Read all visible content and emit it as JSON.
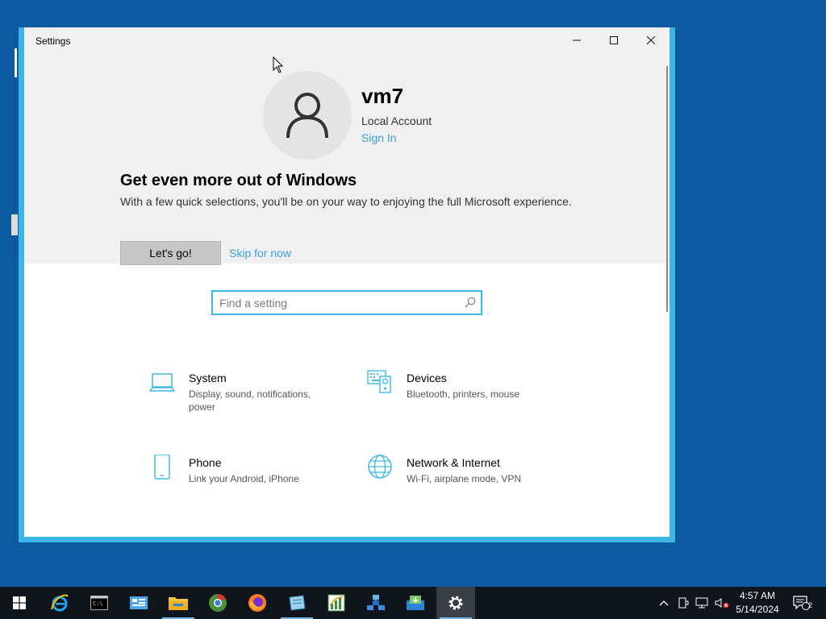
{
  "window": {
    "title": "Settings"
  },
  "account": {
    "username": "vm7",
    "type": "Local Account",
    "sign_in": "Sign In"
  },
  "promo": {
    "title": "Get even more out of Windows",
    "text": "With a few quick selections, you'll be on your way to enjoying the full Microsoft experience.",
    "go_button": "Let's go!",
    "skip_link": "Skip for now"
  },
  "search": {
    "placeholder": "Find a setting"
  },
  "categories": [
    {
      "title": "System",
      "desc": "Display, sound, notifications, power",
      "icon": "laptop-icon"
    },
    {
      "title": "Devices",
      "desc": "Bluetooth, printers, mouse",
      "icon": "devices-icon"
    },
    {
      "title": "Phone",
      "desc": "Link your Android, iPhone",
      "icon": "phone-icon"
    },
    {
      "title": "Network & Internet",
      "desc": "Wi-Fi, airplane mode, VPN",
      "icon": "globe-icon"
    }
  ],
  "taskbar": {
    "items": [
      "start-icon",
      "ie-icon",
      "cmd-icon",
      "explorer-icon",
      "folder-icon",
      "chrome-icon",
      "firefox-icon",
      "notepad-icon",
      "chart-icon",
      "network-icon",
      "inbox-icon",
      "settings-icon"
    ],
    "time": "4:57 AM",
    "date": "5/14/2024",
    "notifications_count": "2"
  },
  "colors": {
    "accent": "#3fb7e6",
    "link": "#3a9fdc",
    "desktop": "#0c5aa0",
    "taskbar": "#10151c"
  }
}
